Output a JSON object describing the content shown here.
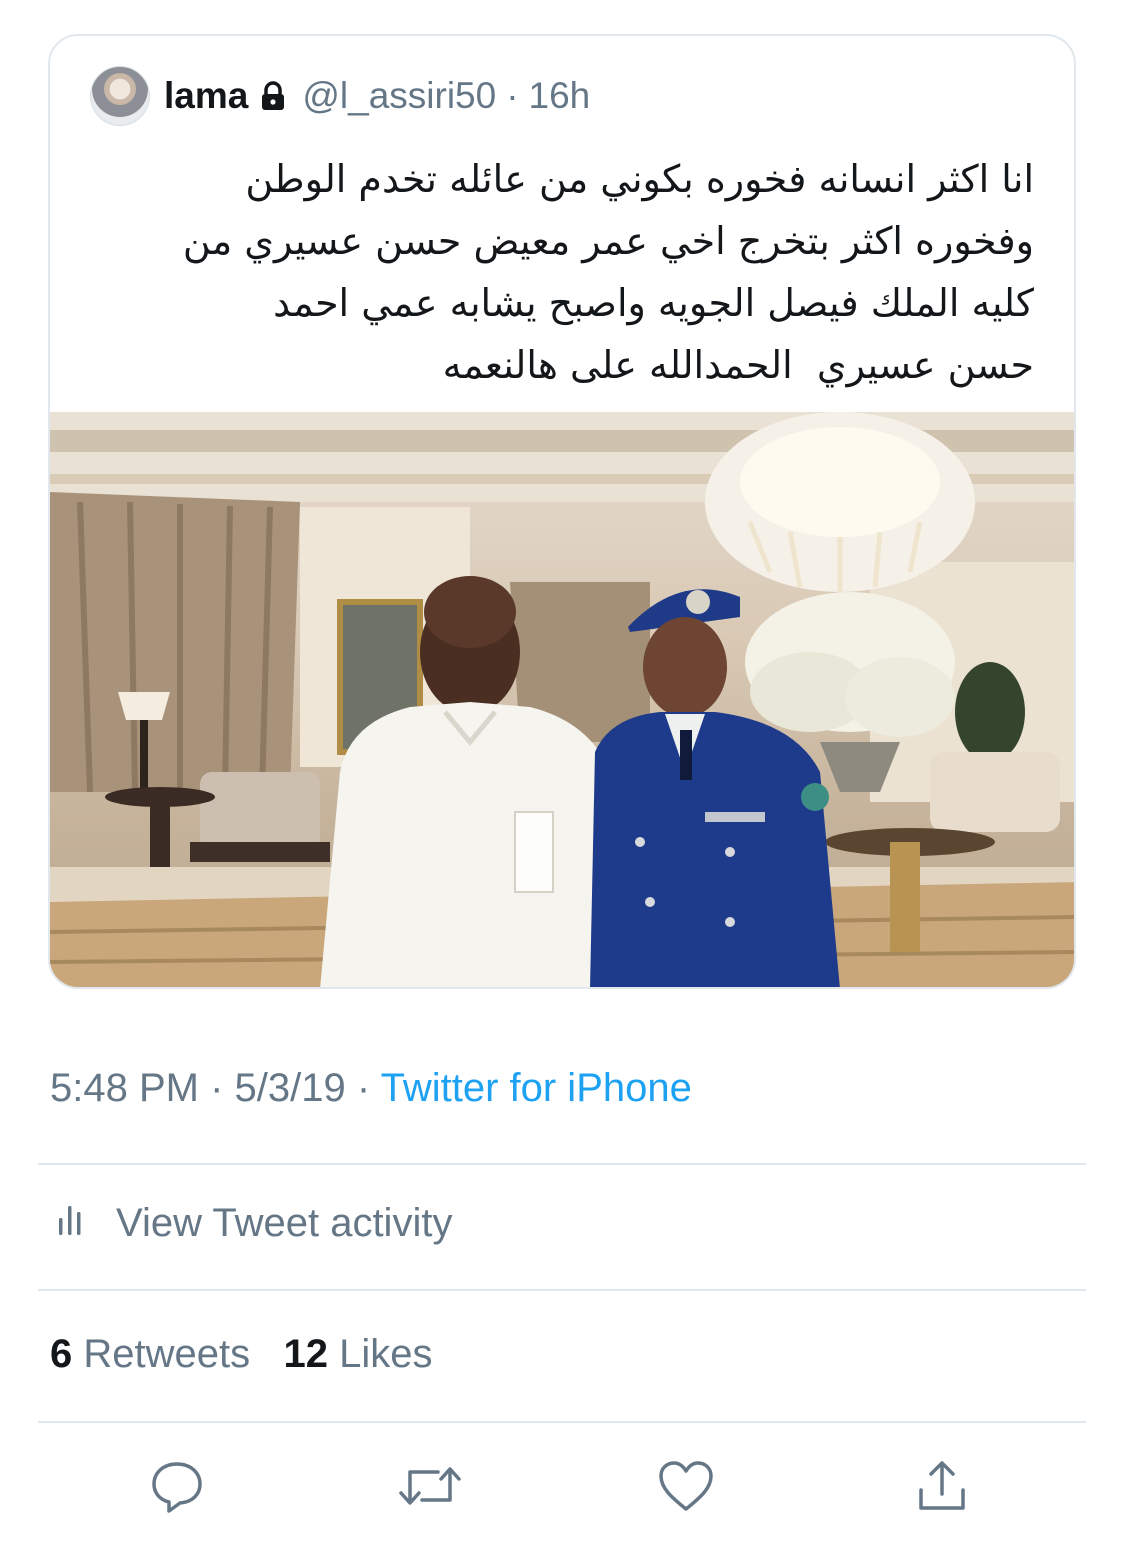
{
  "quoted_tweet": {
    "user_name": "lama",
    "handle": "@l_assiri50",
    "separator": "·",
    "time": "16h",
    "text": "انا اكثر انسانه فخوره بكوني من عائله تخدم الوطن\nوفخوره اكثر بتخرج اخي عمر معيض حسن عسيري من\nكليه الملك فيصل الجويه واصبح يشابه عمي احمد\nحسن عسيري  الحمدالله على هالنعمه",
    "icons": {
      "avatar": "avatar",
      "lock": "lock-icon"
    }
  },
  "meta": {
    "time": "5:48 PM",
    "date": "5/3/19",
    "separator": "·",
    "source": "Twitter for iPhone",
    "source_color": "#1da1f2"
  },
  "activity": {
    "label": "View Tweet activity",
    "icon": "bar-chart-icon"
  },
  "counts": {
    "retweets_count": "6",
    "retweets_label": "Retweets",
    "likes_count": "12",
    "likes_label": "Likes"
  },
  "actions": [
    {
      "icon": "reply-icon"
    },
    {
      "icon": "retweet-icon"
    },
    {
      "icon": "like-icon"
    },
    {
      "icon": "share-icon"
    }
  ],
  "colors": {
    "text": "#14171a",
    "secondary": "#657786",
    "accent": "#1da1f2",
    "border": "#e1e8ed"
  }
}
